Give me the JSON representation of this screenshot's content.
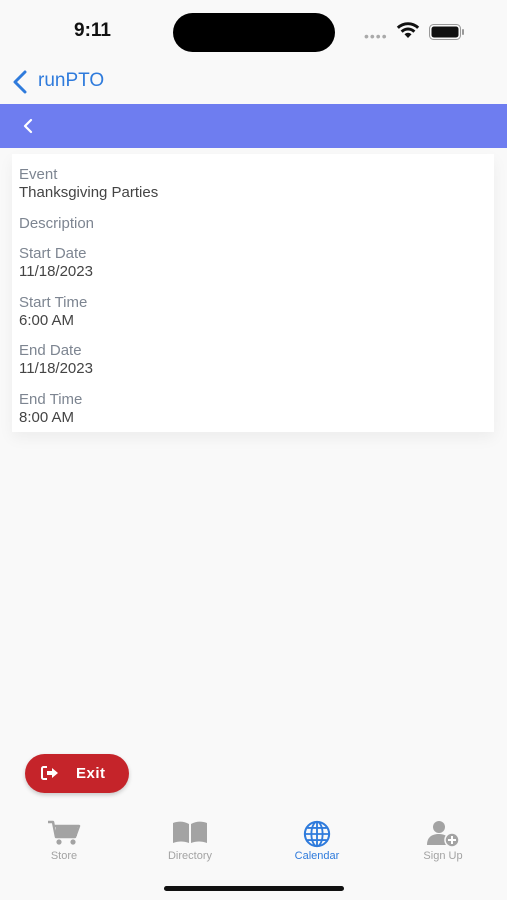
{
  "status_bar": {
    "time": "9:11",
    "signal": "••••"
  },
  "nav": {
    "back_title": "runPTO"
  },
  "event": {
    "fields": [
      {
        "label": "Event",
        "value": "Thanksgiving Parties"
      },
      {
        "label": "Description",
        "value": ""
      },
      {
        "label": "Start Date",
        "value": "11/18/2023"
      },
      {
        "label": "Start Time",
        "value": "6:00 AM"
      },
      {
        "label": "End Date",
        "value": "11/18/2023"
      },
      {
        "label": "End Time",
        "value": "8:00 AM"
      }
    ]
  },
  "exit_button": {
    "label": "Exit"
  },
  "tabs": [
    {
      "label": "Store",
      "icon": "cart-icon"
    },
    {
      "label": "Directory",
      "icon": "book-icon"
    },
    {
      "label": "Calendar",
      "icon": "globe-icon",
      "active": true
    },
    {
      "label": "Sign Up",
      "icon": "add-user-icon"
    }
  ],
  "colors": {
    "accent": "#2f7bdc",
    "header": "#6e7df0",
    "exit": "#c5242a",
    "inactive": "#a3a3a3"
  }
}
